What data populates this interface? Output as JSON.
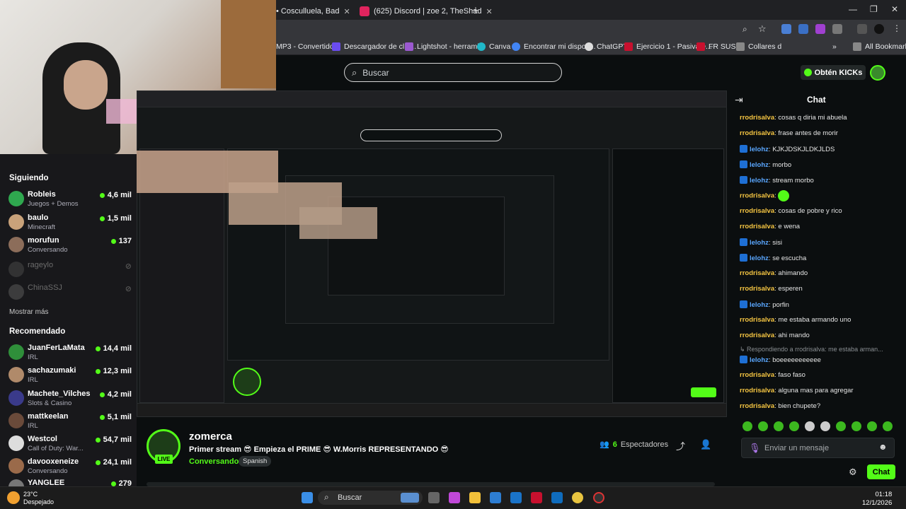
{
  "browser": {
    "tabs": [
      {
        "label": "• Cosculluela, Bad"
      },
      {
        "label": "(625) Discord | zoe 2, TheShad"
      }
    ],
    "bookmarks": [
      "MP3 - Convertido...",
      "Descargador de clip...",
      "Lightshot - herrami...",
      "Canva",
      "Encontrar mi dispos...",
      "ChatGPT",
      "Ejercicio 1 - Pasiva e...",
      "FR SUSB",
      "Collares d"
    ],
    "all_bookmarks": "All Bookmarks"
  },
  "header": {
    "search_placeholder": "Buscar",
    "kick_button": "Obtén KICKs"
  },
  "sidebar": {
    "following_title": "Siguiendo",
    "following": [
      {
        "name": "Robleis",
        "sub": "Juegos + Demos",
        "viewers": "4,6 mil",
        "color": "#2fa84f"
      },
      {
        "name": "baulo",
        "sub": "Minecraft",
        "viewers": "1,5 mil",
        "color": "#c9a27a"
      },
      {
        "name": "morufun",
        "sub": "Conversando",
        "viewers": "137",
        "color": "#8c6d5a"
      },
      {
        "name": "rageylo",
        "sub": "",
        "viewers": "",
        "color": "#555"
      },
      {
        "name": "ChinaSSJ",
        "sub": "",
        "viewers": "",
        "color": "#666"
      }
    ],
    "show_more": "Mostrar más",
    "recommended_title": "Recomendado",
    "recommended": [
      {
        "name": "JuanFerLaMata",
        "sub": "IRL",
        "viewers": "14,4 mil",
        "color": "#2f8f3a"
      },
      {
        "name": "sachazumaki",
        "sub": "IRL",
        "viewers": "12,3 mil",
        "color": "#b08a6a"
      },
      {
        "name": "Machete_Vilches",
        "sub": "Slots & Casino",
        "viewers": "4,2 mil",
        "color": "#3a3a8a"
      },
      {
        "name": "mattkeelan",
        "sub": "IRL",
        "viewers": "5,1 mil",
        "color": "#6a4a3a"
      },
      {
        "name": "Westcol",
        "sub": "Call of Duty: War...",
        "viewers": "54,7 mil",
        "color": "#ddd"
      },
      {
        "name": "davooxeneize",
        "sub": "Conversando",
        "viewers": "24,1 mil",
        "color": "#9a6a4a"
      },
      {
        "name": "YANGLEE",
        "sub": "",
        "viewers": "279",
        "color": "#777"
      }
    ]
  },
  "stream": {
    "name": "zomerca",
    "live": "LIVE",
    "title": "Primer stream 😎 Empieza el PRIME 😎 W.Morris REPRESENTANDO 😎",
    "category": "Conversando",
    "tag": "Spanish",
    "viewers_count": "6",
    "viewers_label": "Espectadores"
  },
  "chat": {
    "title": "Chat",
    "messages": [
      {
        "user": "rrodrisalva",
        "text": "cosas q diria mi abuela",
        "badge": false
      },
      {
        "user": "rrodrisalva",
        "text": "frase antes de morir",
        "badge": false
      },
      {
        "user": "lelohz",
        "text": "KJKJDSKJLDKJLDS",
        "badge": true
      },
      {
        "user": "lelohz",
        "text": "morbo",
        "badge": true
      },
      {
        "user": "lelohz",
        "text": "stream morbo",
        "badge": true
      },
      {
        "user": "rrodrisalva",
        "text": "",
        "badge": false,
        "emoji": true
      },
      {
        "user": "rrodrisalva",
        "text": "cosas de pobre y rico",
        "badge": false
      },
      {
        "user": "rrodrisalva",
        "text": "e wena",
        "badge": false
      },
      {
        "user": "lelohz",
        "text": "sisi",
        "badge": true
      },
      {
        "user": "lelohz",
        "text": "se escucha",
        "badge": true
      },
      {
        "user": "rrodrisalva",
        "text": "ahimando",
        "badge": false
      },
      {
        "user": "rrodrisalva",
        "text": "esperen",
        "badge": false
      },
      {
        "user": "lelohz",
        "text": "porfin",
        "badge": true
      },
      {
        "user": "rrodrisalva",
        "text": "me estaba armando uno",
        "badge": false
      },
      {
        "user": "rrodrisalva",
        "text": "ahi mando",
        "badge": false
      }
    ],
    "reply_note": "Respondiendo a rrodrisalva: me estaba arman...",
    "messages2": [
      {
        "user": "lelohz",
        "text": "boeeeeeeeeeee",
        "badge": true
      },
      {
        "user": "rrodrisalva",
        "text": "faso faso",
        "badge": false
      },
      {
        "user": "rrodrisalva",
        "text": "alguna mas para agregar",
        "badge": false
      },
      {
        "user": "rrodrisalva",
        "text": "bien chupete?",
        "badge": false
      }
    ],
    "input_placeholder": "Enviar un mensaje",
    "send_button": "Chat"
  },
  "taskbar": {
    "temp": "23°C",
    "weather": "Despejado",
    "search": "Buscar",
    "time": "01:18",
    "date": "12/1/2026"
  }
}
